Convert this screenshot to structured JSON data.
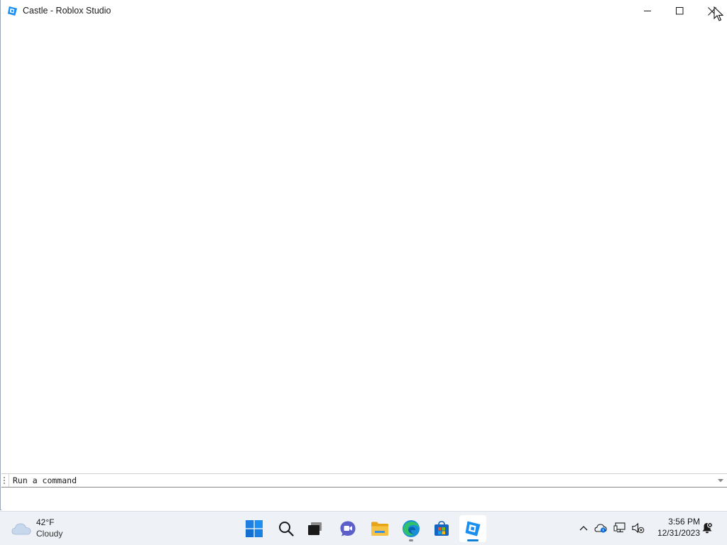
{
  "window": {
    "title": "Castle - Roblox Studio",
    "app_icon": "roblox-studio-icon",
    "controls": [
      "minimize-icon",
      "maximize-icon",
      "close-icon"
    ]
  },
  "command_bar": {
    "value": "Run a command",
    "dropdown_icon": "chevron-down-icon"
  },
  "taskbar": {
    "weather": {
      "temperature": "42°F",
      "condition": "Cloudy",
      "icon": "cloud-icon"
    },
    "apps": [
      {
        "name": "start",
        "icon": "windows-start-icon"
      },
      {
        "name": "search",
        "icon": "search-icon"
      },
      {
        "name": "task-view",
        "icon": "task-view-icon"
      },
      {
        "name": "chat",
        "icon": "teams-chat-icon"
      },
      {
        "name": "file-explorer",
        "icon": "folder-icon"
      },
      {
        "name": "edge",
        "icon": "edge-browser-icon"
      },
      {
        "name": "store",
        "icon": "store-icon"
      },
      {
        "name": "roblox-studio",
        "icon": "roblox-studio-icon",
        "active": true
      }
    ],
    "tray": [
      "chevron-up-icon",
      "onedrive-icon",
      "network-icon",
      "volume-muted-icon"
    ],
    "clock": {
      "time": "3:56 PM",
      "date": "12/31/2023"
    },
    "notifications_icon": "notification-bell-icon",
    "colors": {
      "background": "#eef1f6",
      "roblox_blue": "#0d7fd6",
      "start_blue": "#0a6fd8",
      "edge_green": "#34a853",
      "folder_yellow": "#f2b42b"
    }
  }
}
